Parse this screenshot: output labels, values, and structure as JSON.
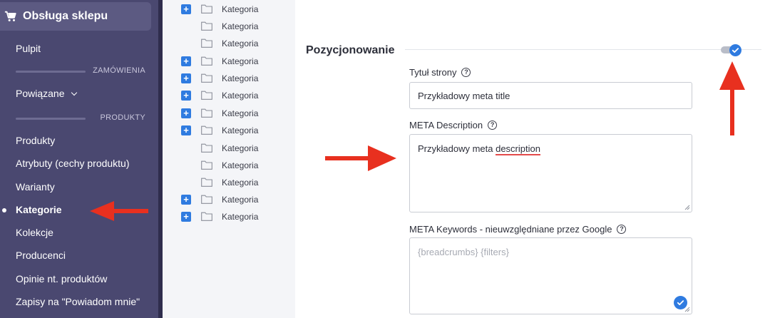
{
  "sidebar": {
    "header_title": "Obsługa sklepu",
    "pulpit": "Pulpit",
    "section_orders": "ZAMÓWIENIA",
    "related": "Powiązane",
    "section_products": "PRODUKTY",
    "items": [
      "Produkty",
      "Atrybuty (cechy produktu)",
      "Warianty",
      "Kategorie",
      "Kolekcje",
      "Producenci",
      "Opinie nt. produktów",
      "Zapisy na \"Powiadom mnie\""
    ],
    "active_item": "Kategorie"
  },
  "tree": {
    "rows": [
      {
        "label": "Kategoria",
        "expandable": true
      },
      {
        "label": "Kategoria",
        "expandable": false
      },
      {
        "label": "Kategoria",
        "expandable": false
      },
      {
        "label": "Kategoria",
        "expandable": true
      },
      {
        "label": "Kategoria",
        "expandable": true
      },
      {
        "label": "Kategoria",
        "expandable": true
      },
      {
        "label": "Kategoria",
        "expandable": true
      },
      {
        "label": "Kategoria",
        "expandable": true
      },
      {
        "label": "Kategoria",
        "expandable": false
      },
      {
        "label": "Kategoria",
        "expandable": false
      },
      {
        "label": "Kategoria",
        "expandable": false
      },
      {
        "label": "Kategoria",
        "expandable": true
      },
      {
        "label": "Kategoria",
        "expandable": true
      }
    ],
    "expand_glyph": "+"
  },
  "seo": {
    "section_title": "Pozycjonowanie",
    "toggle_enabled": true,
    "page_title_label": "Tytuł strony",
    "page_title_value": "Przykładowy meta title",
    "meta_description_label": "META Description",
    "meta_description_value_prefix": "Przykładowy meta ",
    "meta_description_value_misspelled": "description",
    "meta_keywords_label": "META Keywords - nieuwzględniane przez Google",
    "meta_keywords_placeholder": "{breadcrumbs} {filters}",
    "help_glyph": "?"
  },
  "colors": {
    "sidebar_bg": "#4a4870",
    "accent_blue": "#2f7be0",
    "annotation_red": "#e8301f"
  }
}
